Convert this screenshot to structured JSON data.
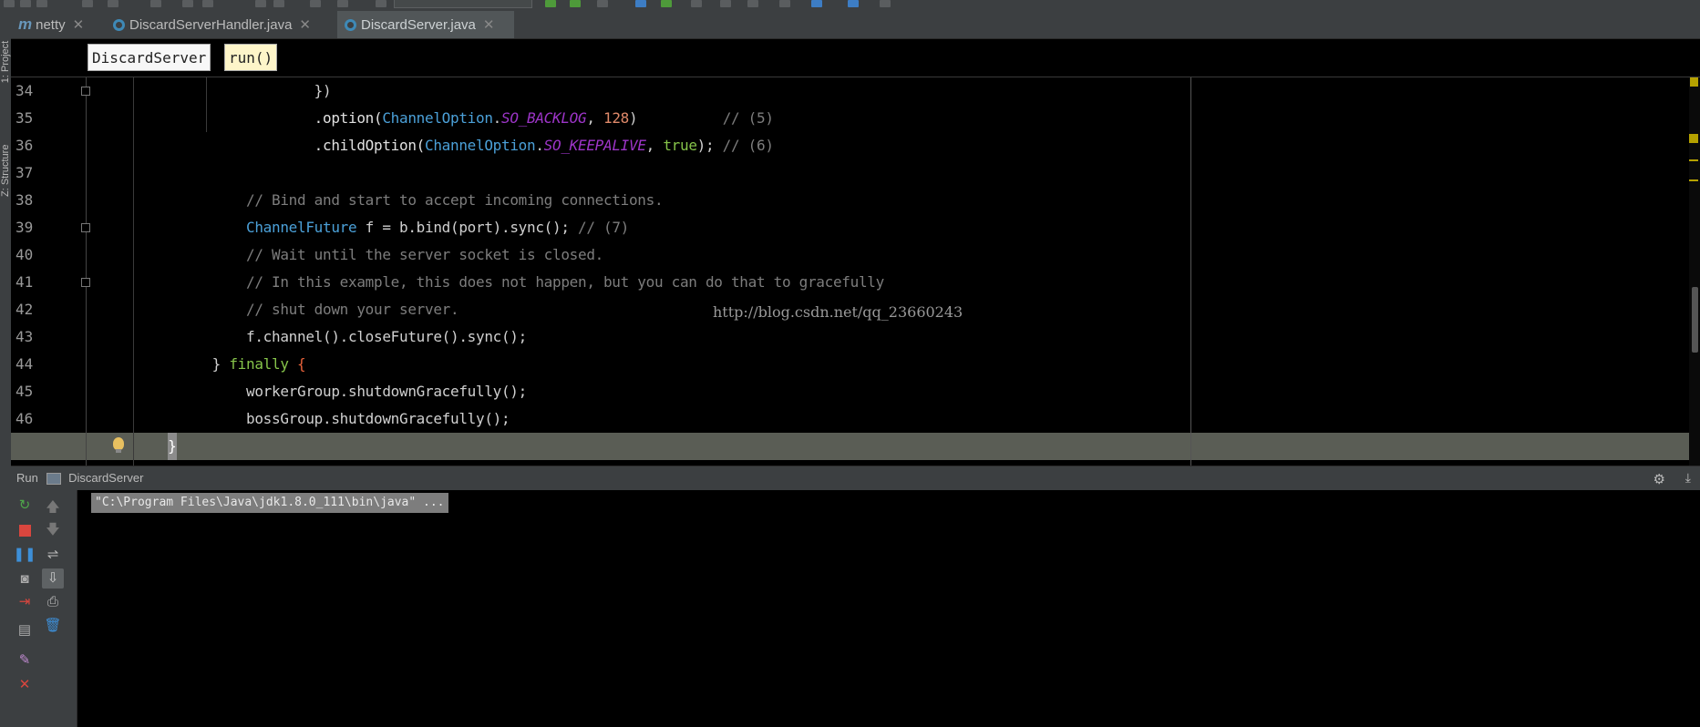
{
  "app": {
    "side_labels": {
      "project": "1: Project",
      "structure": "Z: Structure"
    }
  },
  "tabs": [
    {
      "label": "netty",
      "icon": "module-icon",
      "active": false
    },
    {
      "label": "DiscardServerHandler.java",
      "icon": "java-class-icon",
      "active": false
    },
    {
      "label": "DiscardServer.java",
      "icon": "java-class-icon",
      "active": true
    }
  ],
  "breadcrumbs": {
    "class": "DiscardServer",
    "method": "run()"
  },
  "editor": {
    "lines": [
      {
        "n": "34",
        "tokens": [
          {
            "t": "                    })",
            "c": ""
          }
        ]
      },
      {
        "n": "35",
        "tokens": [
          {
            "t": "                    .option(",
            "c": "t-fn"
          },
          {
            "t": "ChannelOption",
            "c": "t-cls"
          },
          {
            "t": ".",
            "c": ""
          },
          {
            "t": "SO_BACKLOG",
            "c": "t-const"
          },
          {
            "t": ", ",
            "c": ""
          },
          {
            "t": "128",
            "c": "t-num"
          },
          {
            "t": ")          ",
            "c": ""
          },
          {
            "t": "// (5)",
            "c": "t-cmt"
          }
        ]
      },
      {
        "n": "36",
        "tokens": [
          {
            "t": "                    .childOption(",
            "c": "t-fn"
          },
          {
            "t": "ChannelOption",
            "c": "t-cls"
          },
          {
            "t": ".",
            "c": ""
          },
          {
            "t": "SO_KEEPALIVE",
            "c": "t-const"
          },
          {
            "t": ", ",
            "c": ""
          },
          {
            "t": "true",
            "c": "t-kw"
          },
          {
            "t": "); ",
            "c": ""
          },
          {
            "t": "// (6)",
            "c": "t-cmt"
          }
        ]
      },
      {
        "n": "37",
        "tokens": [
          {
            "t": "",
            "c": ""
          }
        ]
      },
      {
        "n": "38",
        "tokens": [
          {
            "t": "            ",
            "c": ""
          },
          {
            "t": "// Bind and start to accept incoming connections.",
            "c": "t-cmt"
          }
        ]
      },
      {
        "n": "39",
        "tokens": [
          {
            "t": "            ",
            "c": ""
          },
          {
            "t": "ChannelFuture",
            "c": "t-cls"
          },
          {
            "t": " f = b.bind(port).sync(); ",
            "c": ""
          },
          {
            "t": "// (7)",
            "c": "t-cmt"
          }
        ]
      },
      {
        "n": "40",
        "tokens": [
          {
            "t": "            ",
            "c": ""
          },
          {
            "t": "// Wait until the server socket is closed.",
            "c": "t-cmt"
          }
        ]
      },
      {
        "n": "41",
        "tokens": [
          {
            "t": "            ",
            "c": ""
          },
          {
            "t": "// In this example, this does not happen, but you can do that to gracefully",
            "c": "t-cmt"
          }
        ]
      },
      {
        "n": "42",
        "tokens": [
          {
            "t": "            ",
            "c": ""
          },
          {
            "t": "// shut down your server.",
            "c": "t-cmt"
          }
        ]
      },
      {
        "n": "43",
        "tokens": [
          {
            "t": "            f.channel().closeFuture().sync();",
            "c": ""
          }
        ]
      },
      {
        "n": "44",
        "tokens": [
          {
            "t": "        } ",
            "c": ""
          },
          {
            "t": "finally",
            "c": "t-kw"
          },
          {
            "t": " {",
            "c": "t-brace"
          }
        ]
      },
      {
        "n": "45",
        "tokens": [
          {
            "t": "            workerGroup.shutdownGracefully();",
            "c": ""
          }
        ]
      },
      {
        "n": "46",
        "tokens": [
          {
            "t": "            bossGroup.shutdownGracefully();",
            "c": ""
          }
        ]
      }
    ],
    "cursor_line_text": "}",
    "watermark": "http://blog.csdn.net/qq_23660243"
  },
  "run_panel": {
    "label": "Run",
    "config_name": "DiscardServer",
    "command": "\"C:\\Program Files\\Java\\jdk1.8.0_111\\bin\\java\" ..."
  },
  "colors": {
    "class": "#4ba0d8",
    "constant": "#9d35c8",
    "number": "#e08a6a",
    "keyword": "#86c44a",
    "comment": "#7d7d7d",
    "cursor_line": "#5a5d55",
    "panel": "#3c3f41"
  }
}
